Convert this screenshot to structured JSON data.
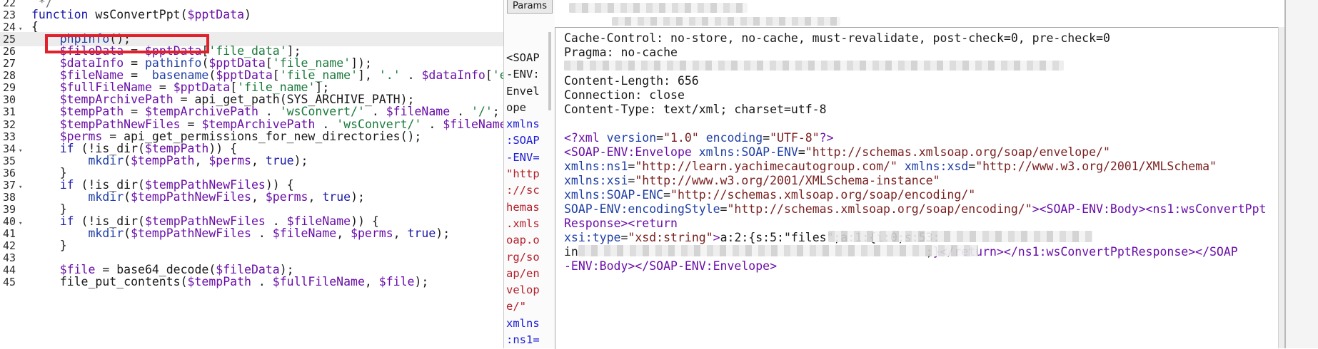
{
  "editor": {
    "lines": [
      {
        "n": "22",
        "tokens": [
          [
            "t-cmt",
            " */"
          ]
        ]
      },
      {
        "n": "23",
        "tokens": [
          [
            "t-kw",
            "function "
          ],
          [
            "t-plain",
            "wsConvertPpt("
          ],
          [
            "t-var",
            "$pptData"
          ],
          [
            "t-plain",
            ")"
          ]
        ]
      },
      {
        "n": "24",
        "fold": true,
        "tokens": [
          [
            "t-plain",
            "{"
          ]
        ]
      },
      {
        "n": "25",
        "active": true,
        "tokens": [
          [
            "t-fn",
            "    phpinfo"
          ],
          [
            "t-plain",
            "();"
          ]
        ]
      },
      {
        "n": "26",
        "tokens": [
          [
            "t-var",
            "    $fileData"
          ],
          [
            "t-plain",
            " = "
          ],
          [
            "t-var",
            "$pptData"
          ],
          [
            "t-plain",
            "["
          ],
          [
            "t-str",
            "'file_data'"
          ],
          [
            "t-plain",
            "];"
          ]
        ]
      },
      {
        "n": "27",
        "tokens": [
          [
            "t-var",
            "    $dataInfo"
          ],
          [
            "t-plain",
            " = "
          ],
          [
            "t-fn",
            "pathinfo"
          ],
          [
            "t-plain",
            "("
          ],
          [
            "t-var",
            "$pptData"
          ],
          [
            "t-plain",
            "["
          ],
          [
            "t-str",
            "'file_name'"
          ],
          [
            "t-plain",
            "]);"
          ]
        ]
      },
      {
        "n": "28",
        "tokens": [
          [
            "t-var",
            "    $fileName"
          ],
          [
            "t-plain",
            " =  "
          ],
          [
            "t-fn",
            "basename"
          ],
          [
            "t-plain",
            "("
          ],
          [
            "t-var",
            "$pptData"
          ],
          [
            "t-plain",
            "["
          ],
          [
            "t-str",
            "'file_name'"
          ],
          [
            "t-plain",
            "], "
          ],
          [
            "t-str",
            "'.'"
          ],
          [
            "t-plain",
            " . "
          ],
          [
            "t-var",
            "$dataInfo"
          ],
          [
            "t-plain",
            "["
          ],
          [
            "t-str",
            "'ext"
          ]
        ]
      },
      {
        "n": "29",
        "tokens": [
          [
            "t-var",
            "    $fullFileName"
          ],
          [
            "t-plain",
            " = "
          ],
          [
            "t-var",
            "$pptData"
          ],
          [
            "t-plain",
            "["
          ],
          [
            "t-str",
            "'file_name'"
          ],
          [
            "t-plain",
            "];"
          ]
        ]
      },
      {
        "n": "30",
        "tokens": [
          [
            "t-var",
            "    $tempArchivePath"
          ],
          [
            "t-plain",
            " = api_get_path(SYS_ARCHIVE_PATH);"
          ]
        ]
      },
      {
        "n": "31",
        "tokens": [
          [
            "t-var",
            "    $tempPath"
          ],
          [
            "t-plain",
            " = "
          ],
          [
            "t-var",
            "$tempArchivePath"
          ],
          [
            "t-plain",
            " . "
          ],
          [
            "t-str",
            "'wsConvert/'"
          ],
          [
            "t-plain",
            " . "
          ],
          [
            "t-var",
            "$fileName"
          ],
          [
            "t-plain",
            " . "
          ],
          [
            "t-str",
            "'/'"
          ],
          [
            "t-plain",
            ";"
          ]
        ]
      },
      {
        "n": "32",
        "tokens": [
          [
            "t-var",
            "    $tempPathNewFiles"
          ],
          [
            "t-plain",
            " = "
          ],
          [
            "t-var",
            "$tempArchivePath"
          ],
          [
            "t-plain",
            " . "
          ],
          [
            "t-str",
            "'wsConvert/'"
          ],
          [
            "t-plain",
            " . "
          ],
          [
            "t-var",
            "$fileName"
          ],
          [
            "t-plain",
            " ."
          ]
        ]
      },
      {
        "n": "33",
        "tokens": [
          [
            "t-var",
            "    $perms"
          ],
          [
            "t-plain",
            " = api_get_permissions_for_new_directories();"
          ]
        ]
      },
      {
        "n": "34",
        "fold": true,
        "tokens": [
          [
            "t-kw",
            "    if"
          ],
          [
            "t-plain",
            " (!is_dir("
          ],
          [
            "t-var",
            "$tempPath"
          ],
          [
            "t-plain",
            ")) {"
          ]
        ]
      },
      {
        "n": "35",
        "tokens": [
          [
            "t-fn",
            "        mkdir"
          ],
          [
            "t-plain",
            "("
          ],
          [
            "t-var",
            "$tempPath"
          ],
          [
            "t-plain",
            ", "
          ],
          [
            "t-var",
            "$perms"
          ],
          [
            "t-plain",
            ", "
          ],
          [
            "t-kw",
            "true"
          ],
          [
            "t-plain",
            ");"
          ]
        ]
      },
      {
        "n": "36",
        "tokens": [
          [
            "t-plain",
            "    }"
          ]
        ]
      },
      {
        "n": "37",
        "fold": true,
        "tokens": [
          [
            "t-kw",
            "    if"
          ],
          [
            "t-plain",
            " (!is_dir("
          ],
          [
            "t-var",
            "$tempPathNewFiles"
          ],
          [
            "t-plain",
            ")) {"
          ]
        ]
      },
      {
        "n": "38",
        "tokens": [
          [
            "t-fn",
            "        mkdir"
          ],
          [
            "t-plain",
            "("
          ],
          [
            "t-var",
            "$tempPathNewFiles"
          ],
          [
            "t-plain",
            ", "
          ],
          [
            "t-var",
            "$perms"
          ],
          [
            "t-plain",
            ", "
          ],
          [
            "t-kw",
            "true"
          ],
          [
            "t-plain",
            ");"
          ]
        ]
      },
      {
        "n": "39",
        "tokens": [
          [
            "t-plain",
            "    }"
          ]
        ]
      },
      {
        "n": "40",
        "fold": true,
        "tokens": [
          [
            "t-kw",
            "    if"
          ],
          [
            "t-plain",
            " (!is_dir("
          ],
          [
            "t-var",
            "$tempPathNewFiles"
          ],
          [
            "t-plain",
            " . "
          ],
          [
            "t-var",
            "$fileName"
          ],
          [
            "t-plain",
            ")) {"
          ]
        ]
      },
      {
        "n": "41",
        "tokens": [
          [
            "t-fn",
            "        mkdir"
          ],
          [
            "t-plain",
            "("
          ],
          [
            "t-var",
            "$tempPathNewFiles"
          ],
          [
            "t-plain",
            " . "
          ],
          [
            "t-var",
            "$fileName"
          ],
          [
            "t-plain",
            ", "
          ],
          [
            "t-var",
            "$perms"
          ],
          [
            "t-plain",
            ", "
          ],
          [
            "t-kw",
            "true"
          ],
          [
            "t-plain",
            ");"
          ]
        ]
      },
      {
        "n": "42",
        "tokens": [
          [
            "t-plain",
            "    }"
          ]
        ]
      },
      {
        "n": "43",
        "tokens": []
      },
      {
        "n": "44",
        "tokens": [
          [
            "t-var",
            "    $file"
          ],
          [
            "t-plain",
            " = base64_decode("
          ],
          [
            "t-var",
            "$fileData"
          ],
          [
            "t-plain",
            ");"
          ]
        ]
      },
      {
        "n": "45",
        "tokens": [
          [
            "t-plain",
            "    file_put_contents("
          ],
          [
            "t-var",
            "$tempPath"
          ],
          [
            "t-plain",
            " . "
          ],
          [
            "t-var",
            "$fullFileName"
          ],
          [
            "t-plain",
            ", "
          ],
          [
            "t-var",
            "$file"
          ],
          [
            "t-plain",
            ");"
          ]
        ]
      }
    ]
  },
  "request": {
    "tab_label": "Params",
    "lines": [
      [
        "req-plain",
        "<SOAP"
      ],
      [
        "req-plain",
        "-ENV:"
      ],
      [
        "req-plain",
        "Envel"
      ],
      [
        "req-plain",
        "ope"
      ],
      [
        "req-blue",
        "xmlns"
      ],
      [
        "req-blue",
        ":SOAP"
      ],
      [
        "req-blue",
        "-ENV="
      ],
      [
        "req-red",
        "\"http"
      ],
      [
        "req-red",
        "://sc"
      ],
      [
        "req-red",
        "hemas"
      ],
      [
        "req-red",
        ".xmls"
      ],
      [
        "req-red",
        "oap.o"
      ],
      [
        "req-red",
        "rg/so"
      ],
      [
        "req-red",
        "ap/en"
      ],
      [
        "req-red",
        "velop"
      ],
      [
        "req-red",
        "e/\""
      ],
      [
        "req-blue",
        "xmlns"
      ],
      [
        "req-blue",
        ":ns1="
      ]
    ]
  },
  "response": {
    "headers": [
      "Cache-Control: no-store, no-cache, must-revalidate, post-check=0, pre-check=0",
      "Pragma: no-cache",
      "",
      "Content-Length: 656",
      "Connection: close",
      "Content-Type: text/xml; charset=utf-8"
    ],
    "body": [
      [
        [
          "x-tag",
          "<?xml "
        ],
        [
          "x-attr",
          "version"
        ],
        [
          "x-punct",
          "="
        ],
        [
          "x-val",
          "\"1.0\""
        ],
        [
          "x-punct",
          " "
        ],
        [
          "x-attr",
          "encoding"
        ],
        [
          "x-punct",
          "="
        ],
        [
          "x-val",
          "\"UTF-8\""
        ],
        [
          "x-tag",
          "?>"
        ]
      ],
      [
        [
          "x-tag",
          "<SOAP-ENV:Envelope "
        ],
        [
          "x-attr",
          "xmlns:SOAP-ENV"
        ],
        [
          "x-punct",
          "="
        ],
        [
          "x-val",
          "\"http://schemas.xmlsoap.org/soap/envelope/\""
        ]
      ],
      [
        [
          "x-attr",
          "xmlns:ns1"
        ],
        [
          "x-punct",
          "="
        ],
        [
          "x-val",
          "\"http://learn.yachimecautogroup.com/\""
        ],
        [
          "x-punct",
          " "
        ],
        [
          "x-attr",
          "xmlns:xsd"
        ],
        [
          "x-punct",
          "="
        ],
        [
          "x-val",
          "\"http://www.w3.org/2001/XMLSchema\""
        ]
      ],
      [
        [
          "x-attr",
          "xmlns:xsi"
        ],
        [
          "x-punct",
          "="
        ],
        [
          "x-val",
          "\"http://www.w3.org/2001/XMLSchema-instance\""
        ]
      ],
      [
        [
          "x-attr",
          "xmlns:SOAP-ENC"
        ],
        [
          "x-punct",
          "="
        ],
        [
          "x-val",
          "\"http://schemas.xmlsoap.org/soap/encoding/\""
        ]
      ],
      [
        [
          "x-attr",
          "SOAP-ENV:encodingStyle"
        ],
        [
          "x-punct",
          "="
        ],
        [
          "x-val",
          "\"http://schemas.xmlsoap.org/soap/encoding/\""
        ],
        [
          "x-tag",
          "><SOAP-ENV:Body><ns1:wsConvertPpt"
        ]
      ],
      [
        [
          "x-tag",
          "Response><return"
        ]
      ],
      [
        [
          "x-attr",
          "xsi:type"
        ],
        [
          "x-punct",
          "="
        ],
        [
          "x-val",
          "\"xsd:string\""
        ],
        [
          "x-tag",
          ">"
        ],
        [
          "x-punct",
          "a:2:{s:5:\"files\";a:1:{i:0;s:53:"
        ]
      ],
      [
        [
          "x-punct",
          "in"
        ],
        [
          "x-punct",
          "                                                 ;"
        ],
        [
          "x-tag",
          "}</return></ns1:wsConvertPptResponse></SOAP"
        ]
      ],
      [
        [
          "x-tag",
          "-ENV:Body></SOAP-ENV:Envelope>"
        ]
      ]
    ]
  }
}
